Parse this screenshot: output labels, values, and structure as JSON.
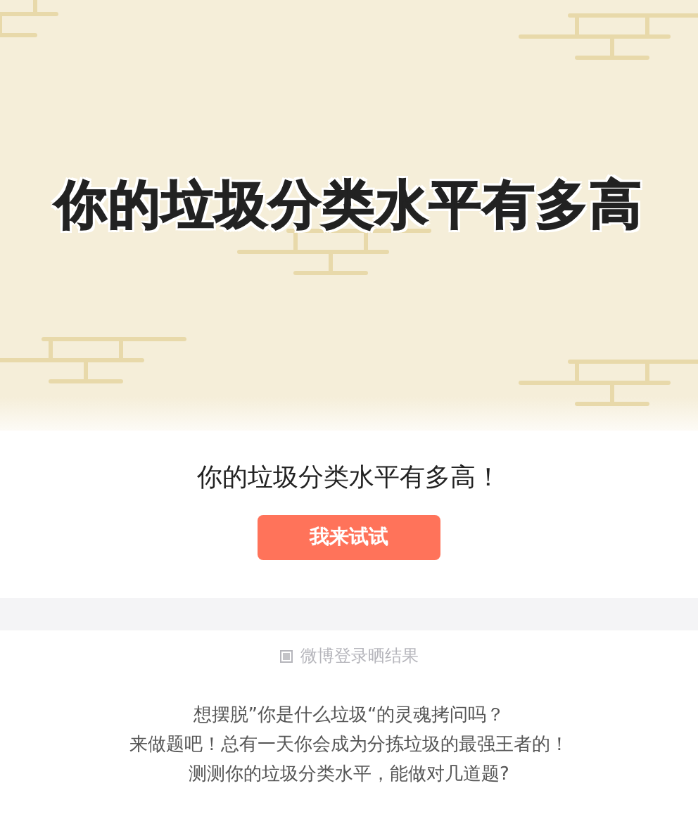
{
  "banner": {
    "title": "你的垃圾分类水平有多高"
  },
  "intro": {
    "heading": "你的垃圾分类水平有多高！",
    "button": "我来试试"
  },
  "share_option": {
    "label": "微博登录晒结果",
    "checked": false
  },
  "description": [
    "想摆脱”你是什么垃圾“的灵魂拷问吗？",
    "来做题吧！总有一天你会成为分拣垃圾的最强王者的！",
    "测测你的垃圾分类水平，能做对几道题?"
  ]
}
